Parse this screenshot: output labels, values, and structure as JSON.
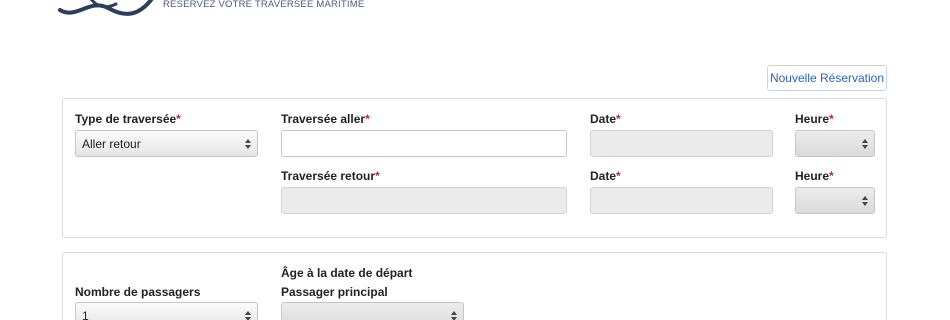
{
  "header": {
    "tagline": "RÉSERVEZ VOTRE TRAVERSÉE MARITIME",
    "logo_icon": "wave-logo-icon",
    "brand_color": "#2c3e5c"
  },
  "actions": {
    "new_reservation": "Nouvelle Réservation"
  },
  "crossing": {
    "type": {
      "label": "Type de traversée",
      "value": "Aller retour"
    },
    "outbound": {
      "label": "Traversée aller",
      "value": ""
    },
    "outbound_date": {
      "label": "Date",
      "value": ""
    },
    "outbound_time": {
      "label": "Heure",
      "value": ""
    },
    "return": {
      "label": "Traversée retour",
      "value": ""
    },
    "return_date": {
      "label": "Date",
      "value": ""
    },
    "return_time": {
      "label": "Heure",
      "value": ""
    },
    "required_mark": "*"
  },
  "passengers": {
    "count_label": "Nombre de passagers",
    "count_value": "1",
    "age_heading": "Âge à la date de départ",
    "main_label": "Passager principal",
    "main_value": ""
  }
}
